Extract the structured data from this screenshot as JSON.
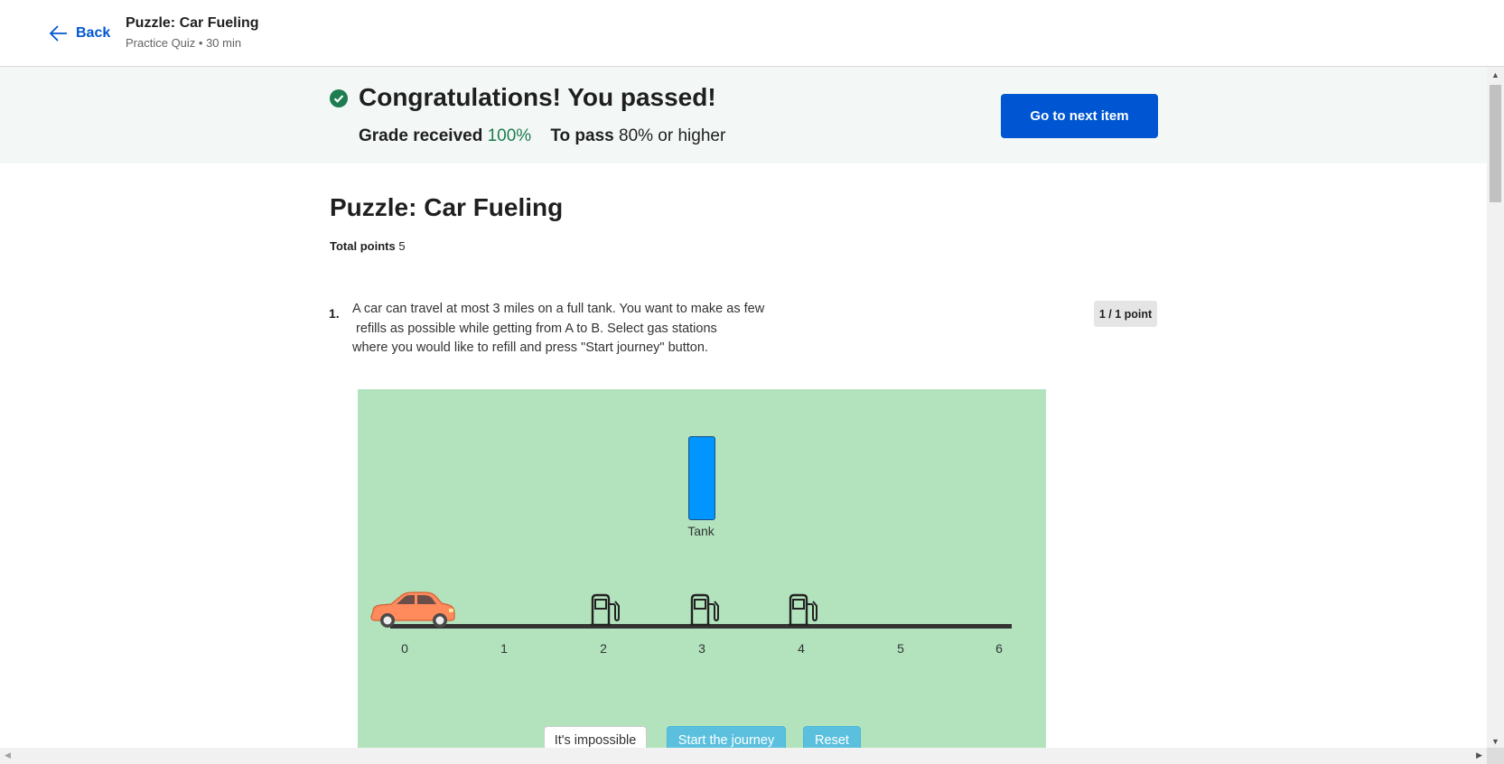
{
  "header": {
    "back_label": "Back",
    "title": "Puzzle: Car Fueling",
    "subtitle": "Practice Quiz • 30 min"
  },
  "banner": {
    "message": "Congratulations! You passed!",
    "grade_label": "Grade received",
    "grade_value": "100%",
    "pass_label": "To pass",
    "pass_value": "80% or higher",
    "next_button": "Go to next item",
    "accent_color": "#1d7c50"
  },
  "quiz": {
    "title": "Puzzle: Car Fueling",
    "total_points_label": "Total points",
    "total_points_value": "5"
  },
  "question": {
    "number": "1.",
    "text_lines": [
      "A car can travel at most 3 miles on a full tank. You want to make as few",
      " refills as possible while getting from A to B. Select gas stations",
      "where you would like to refill and press \"Start journey\" button."
    ],
    "points": "1 / 1 point"
  },
  "puzzle": {
    "tank_label": "Tank",
    "tank_level": 1.0,
    "axis_ticks": [
      "0",
      "1",
      "2",
      "3",
      "4",
      "5",
      "6"
    ],
    "gas_stations_at": [
      2,
      3,
      4
    ],
    "car_position": 0,
    "buttons": {
      "impossible": "It's impossible",
      "start": "Start the journey",
      "reset": "Reset"
    }
  },
  "icons": {
    "back": "arrow-left-icon",
    "passed": "check-circle-icon",
    "car": "car-icon",
    "pump": "gas-pump-icon"
  }
}
